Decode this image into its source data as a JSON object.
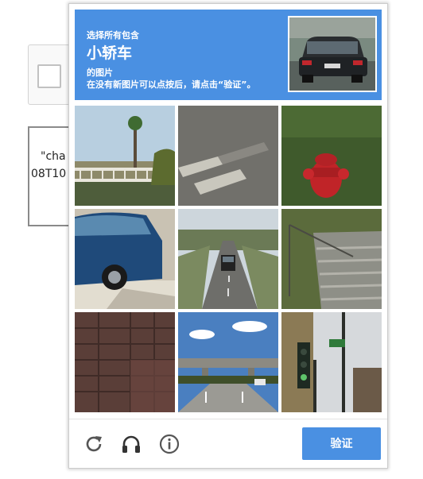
{
  "background": {
    "text_lines": [
      "\"cha",
      "08T10"
    ]
  },
  "captcha": {
    "instruction_prefix": "选择所有包含",
    "target": "小轿车",
    "instruction_suffix": "的图片",
    "instruction_hint": "在没有新图片可以点按后，请点击“验证”。",
    "verify_label": "验证",
    "accent_color": "#4a90e2",
    "footer_icons": [
      "reload-icon",
      "headphones-icon",
      "info-icon"
    ],
    "tiles": [
      {
        "content": "palm tree and bridge railing"
      },
      {
        "content": "crosswalk stripes on asphalt"
      },
      {
        "content": "red fire hydrant on grass"
      },
      {
        "content": "blue car side"
      },
      {
        "content": "car on highway"
      },
      {
        "content": "concrete stairs and railing"
      },
      {
        "content": "brick wall"
      },
      {
        "content": "highway overpass"
      },
      {
        "content": "traffic light and street sign"
      }
    ]
  }
}
